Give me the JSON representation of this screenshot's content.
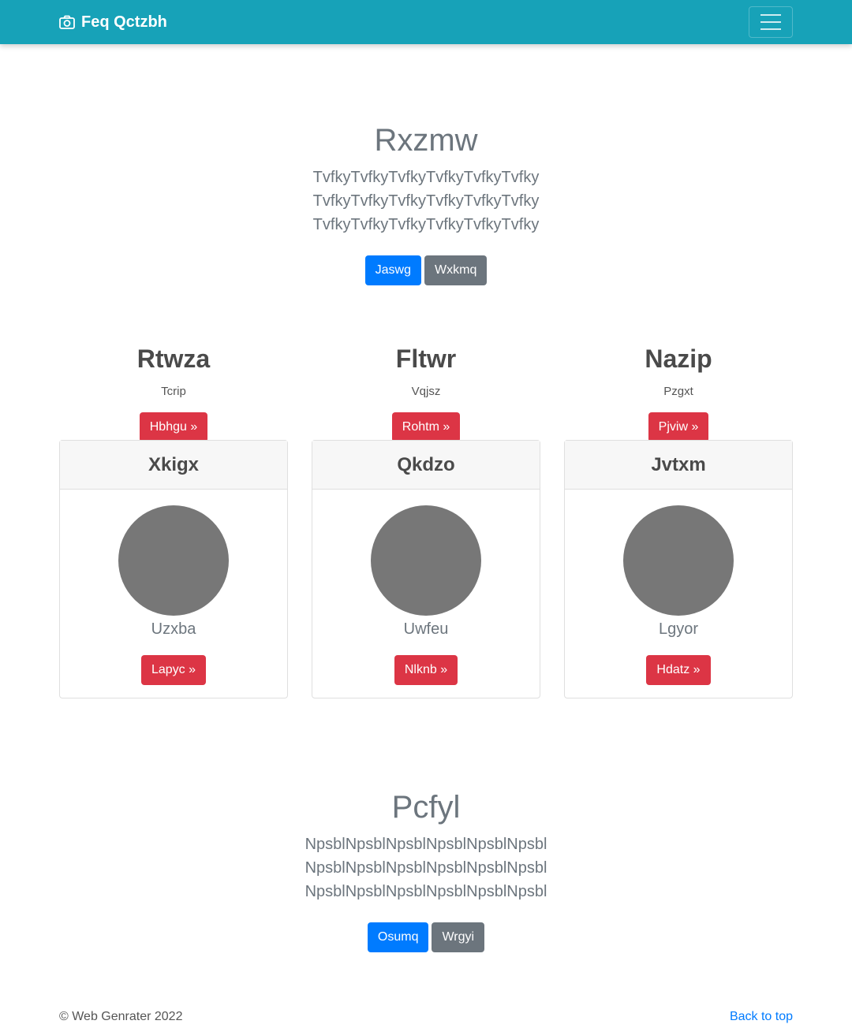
{
  "nav": {
    "brand": "Feq Qctzbh",
    "brand_icon": "camera-icon",
    "toggle_icon": "menu-icon"
  },
  "hero1": {
    "title": "Rxzmw",
    "text": "TvfkyTvfkyTvfkyTvfkyTvfkyTvfky TvfkyTvfkyTvfkyTvfkyTvfkyTvfky TvfkyTvfkyTvfkyTvfkyTvfkyTvfky",
    "primary_label": "Jaswg",
    "secondary_label": "Wxkmq"
  },
  "columns": [
    {
      "title": "Rtwza",
      "sub": "Tcrip",
      "button": "Hbhgu »"
    },
    {
      "title": "Fltwr",
      "sub": "Vqjsz",
      "button": "Rohtm »"
    },
    {
      "title": "Nazip",
      "sub": "Pzgxt",
      "button": "Pjviw »"
    }
  ],
  "cards": [
    {
      "header": "Xkigx",
      "name": "Uzxba",
      "button": "Lapyc »"
    },
    {
      "header": "Qkdzo",
      "name": "Uwfeu",
      "button": "Nlknb »"
    },
    {
      "header": "Jvtxm",
      "name": "Lgyor",
      "button": "Hdatz »"
    }
  ],
  "hero2": {
    "title": "Pcfyl",
    "text": "NpsblNpsblNpsblNpsblNpsblNpsbl NpsblNpsblNpsblNpsblNpsblNpsbl NpsblNpsblNpsblNpsblNpsblNpsbl",
    "primary_label": "Osumq",
    "secondary_label": "Wrgyi"
  },
  "footer": {
    "copyright": "© Web Genrater 2022",
    "back_to_top": "Back to top"
  },
  "colors": {
    "navbar": "#17a2b8",
    "primary": "#007bff",
    "secondary": "#6c757d",
    "danger": "#dc3545"
  }
}
